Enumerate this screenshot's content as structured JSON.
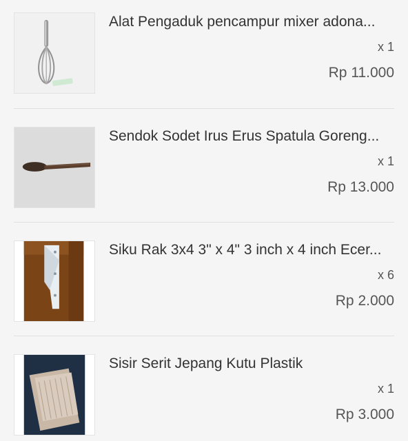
{
  "items": [
    {
      "name": "Alat Pengaduk pencampur mixer adona...",
      "qty": "x 1",
      "price": "Rp 11.000"
    },
    {
      "name": "Sendok Sodet Irus Erus Spatula Goreng...",
      "qty": "x 1",
      "price": "Rp 13.000"
    },
    {
      "name": "Siku Rak 3x4 3\" x 4\" 3 inch x 4 inch Ecer...",
      "qty": "x 6",
      "price": "Rp 2.000"
    },
    {
      "name": "Sisir Serit Jepang Kutu Plastik",
      "qty": "x 1",
      "price": "Rp 3.000"
    }
  ]
}
